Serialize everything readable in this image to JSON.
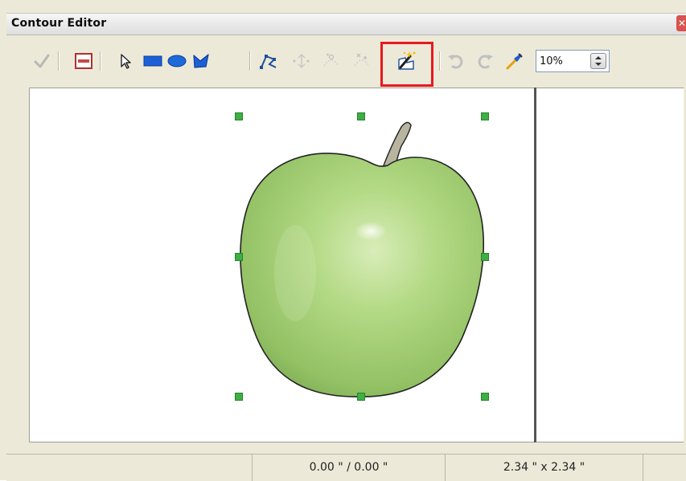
{
  "window": {
    "title": "Contour Editor",
    "close_glyph": "✕"
  },
  "toolbar": {
    "buttons": [
      {
        "id": "apply",
        "icon": "check-icon",
        "enabled": false
      },
      {
        "id": "workspace",
        "icon": "workspace-icon",
        "enabled": true
      },
      {
        "id": "select",
        "icon": "pointer-icon",
        "enabled": true
      },
      {
        "id": "rectangle",
        "icon": "rectangle-icon",
        "enabled": true
      },
      {
        "id": "ellipse",
        "icon": "ellipse-icon",
        "enabled": true
      },
      {
        "id": "polygon",
        "icon": "polygon-icon",
        "enabled": true
      },
      {
        "id": "edit-points",
        "icon": "points-icon",
        "enabled": true
      },
      {
        "id": "move-points",
        "icon": "move-points-icon",
        "enabled": false
      },
      {
        "id": "insert-points",
        "icon": "insert-points-icon",
        "enabled": false
      },
      {
        "id": "delete-points",
        "icon": "delete-points-icon",
        "enabled": false
      },
      {
        "id": "autocontour",
        "icon": "autocontour-icon",
        "enabled": true,
        "highlighted": true
      },
      {
        "id": "undo",
        "icon": "undo-icon",
        "enabled": false
      },
      {
        "id": "redo",
        "icon": "redo-icon",
        "enabled": false
      },
      {
        "id": "pipette",
        "icon": "pipette-icon",
        "enabled": true
      }
    ],
    "zoom_value": "10%"
  },
  "statusbar": {
    "position": "0.00 \" / 0.00 \"",
    "size": "2.34 \" x 2.34 \""
  },
  "colors": {
    "highlight": "#e8181e",
    "handle": "#3cb043",
    "apple": "#a8d07a"
  }
}
